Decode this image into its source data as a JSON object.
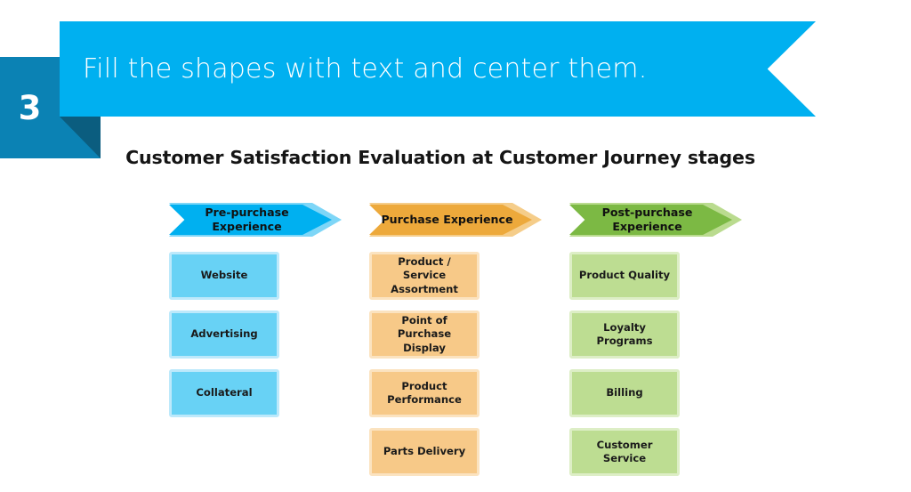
{
  "header": {
    "step_number": "3",
    "instruction": "Fill the shapes with text and center them.",
    "banner_color": "#00b0f0",
    "badge_color": "#0b82b4",
    "badge_fold_color": "#0b5d7f"
  },
  "slide": {
    "title": "Customer Satisfaction Evaluation at Customer Journey stages"
  },
  "columns": [
    {
      "stage_label": "Pre-purchase Experience",
      "arrow_color": "#00b0f0",
      "arrow_outline_color": "#7ed6f7",
      "box_fill": "#68d2f5",
      "box_border": "#bde9fb",
      "items": [
        {
          "label": "Website"
        },
        {
          "label": "Advertising"
        },
        {
          "label": "Collateral"
        }
      ]
    },
    {
      "stage_label": "Purchase Experience",
      "arrow_color": "#eda93b",
      "arrow_outline_color": "#f5cd8a",
      "box_fill": "#f7c988",
      "box_border": "#fbe3c0",
      "items": [
        {
          "label": "Product / Service Assortment"
        },
        {
          "label": "Point of Purchase Display"
        },
        {
          "label": "Product Performance"
        },
        {
          "label": "Parts Delivery"
        }
      ]
    },
    {
      "stage_label": "Post-purchase Experience",
      "arrow_color": "#7cb944",
      "arrow_outline_color": "#badb8f",
      "box_fill": "#bddd92",
      "box_border": "#ddeec6",
      "items": [
        {
          "label": "Product Quality"
        },
        {
          "label": "Loyalty Programs"
        },
        {
          "label": "Billing"
        },
        {
          "label": "Customer Service"
        }
      ]
    }
  ],
  "layout": {
    "row_tops": [
      283,
      349,
      415,
      481
    ]
  }
}
